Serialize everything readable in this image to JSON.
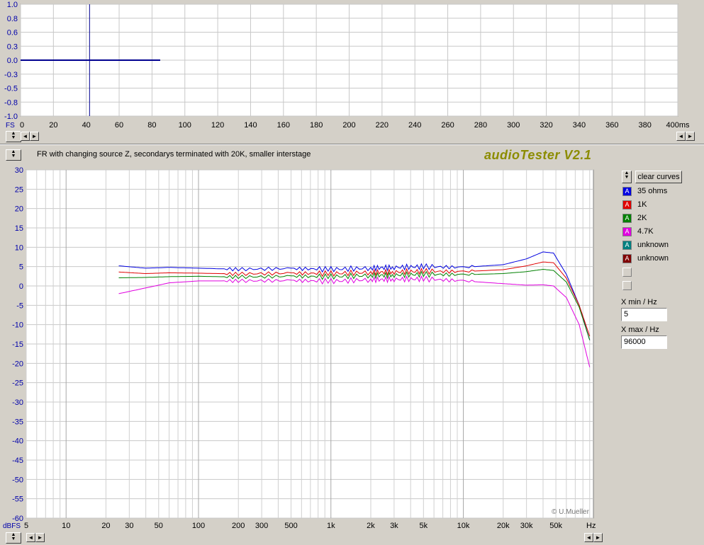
{
  "top_plot": {
    "y_ticks": [
      "1.0",
      "0.8",
      "0.6",
      "0.3",
      "0.0",
      "-0.3",
      "-0.5",
      "-0.8",
      "-1.0"
    ],
    "x_unit_left": "FS",
    "x_ticks": [
      "0",
      "20",
      "40",
      "60",
      "80",
      "100",
      "120",
      "140",
      "160",
      "180",
      "200",
      "220",
      "240",
      "260",
      "280",
      "300",
      "320",
      "340",
      "360",
      "380",
      "400ms"
    ],
    "scroll_left": "◄",
    "scroll_right": "►"
  },
  "bottom_plot": {
    "title": "FR with changing source Z, secondarys terminated with 20K, smaller interstage",
    "brand": "audioTester V2.1",
    "y_unit": "dBFS",
    "x_unit": "Hz",
    "copyright": "© U.Mueller",
    "scroll_left": "◄",
    "scroll_right": "►"
  },
  "side_panel": {
    "clear_button": "clear curves",
    "legend": [
      {
        "label": "35 ohms",
        "color": "#0000e0",
        "glyph": "A"
      },
      {
        "label": "1K",
        "color": "#e00000",
        "glyph": "A"
      },
      {
        "label": "2K",
        "color": "#008000",
        "glyph": "A"
      },
      {
        "label": "4.7K",
        "color": "#e000e0",
        "glyph": "A"
      },
      {
        "label": "unknown",
        "color": "#008080",
        "glyph": "A"
      },
      {
        "label": "unknown",
        "color": "#800000",
        "glyph": "A"
      }
    ],
    "xmin_label": "X min / Hz",
    "xmin_value": "5",
    "xmax_label": "X max / Hz",
    "xmax_value": "96000"
  },
  "chart_data": [
    {
      "type": "line",
      "title": "",
      "xlabel": "ms",
      "ylabel": "FS",
      "xlim": [
        0,
        400
      ],
      "ylim": [
        -1.0,
        1.0
      ],
      "series": [
        {
          "x": [
            0,
            42,
            42,
            42,
            85
          ],
          "y": [
            0,
            0,
            -1.0,
            1.0,
            0
          ]
        }
      ]
    },
    {
      "type": "line",
      "title": "FR with changing source Z, secondarys terminated with 20K, smaller interstage",
      "xlabel": "Hz",
      "ylabel": "dBFS",
      "xscale": "log",
      "xlim": [
        5,
        96000
      ],
      "ylim": [
        -60,
        30
      ],
      "x_ticks": [
        5,
        10,
        20,
        30,
        50,
        100,
        200,
        300,
        500,
        1000,
        2000,
        3000,
        5000,
        10000,
        20000,
        30000,
        50000
      ],
      "x_tick_labels": [
        "5",
        "10",
        "20",
        "30",
        "50",
        "100",
        "200",
        "300",
        "500",
        "1k",
        "2k",
        "3k",
        "5k",
        "10k",
        "20k",
        "30k",
        "50k"
      ],
      "y_ticks": [
        30,
        25,
        20,
        15,
        10,
        5,
        0,
        -5,
        -10,
        -15,
        -20,
        -25,
        -30,
        -35,
        -40,
        -45,
        -50,
        -55,
        -60
      ],
      "grid": true,
      "legend_placement": "right",
      "x": [
        25,
        40,
        60,
        100,
        200,
        500,
        1000,
        2000,
        3000,
        5000,
        10000,
        20000,
        30000,
        40000,
        48000,
        60000,
        75000,
        90000
      ],
      "series": [
        {
          "name": "35 ohms",
          "color": "#0000e0",
          "values": [
            5.2,
            4.6,
            4.8,
            4.6,
            4.3,
            4.5,
            4.3,
            4.6,
            4.8,
            5.0,
            4.8,
            5.5,
            7.0,
            8.8,
            8.5,
            3.0,
            -5.0,
            -14.0
          ]
        },
        {
          "name": "1K",
          "color": "#e00000",
          "values": [
            3.6,
            3.2,
            3.4,
            3.3,
            3.1,
            3.3,
            3.2,
            3.5,
            3.6,
            3.8,
            3.7,
            4.2,
            5.2,
            6.2,
            6.0,
            2.0,
            -5.0,
            -13.0
          ]
        },
        {
          "name": "2K",
          "color": "#008000",
          "values": [
            2.1,
            2.2,
            2.4,
            2.5,
            2.3,
            2.5,
            2.4,
            2.7,
            2.8,
            3.0,
            2.9,
            3.2,
            3.7,
            4.3,
            4.0,
            1.0,
            -5.5,
            -14.0
          ]
        },
        {
          "name": "4.7K",
          "color": "#e000e0",
          "values": [
            -2.0,
            -0.5,
            0.8,
            1.3,
            1.3,
            1.4,
            1.2,
            1.6,
            1.7,
            1.8,
            1.3,
            0.6,
            0.2,
            0.3,
            0.0,
            -3.0,
            -10.0,
            -21.0
          ]
        }
      ]
    }
  ]
}
